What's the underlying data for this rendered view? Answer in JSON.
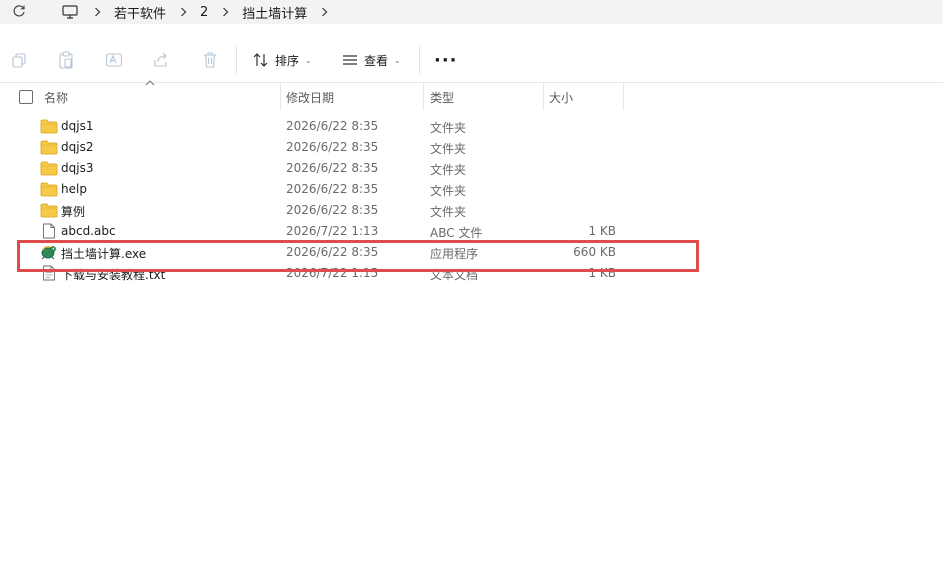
{
  "address_bar": {
    "crumbs": [
      "若干软件",
      "2",
      "挡土墙计算"
    ]
  },
  "toolbar": {
    "sort_label": "排序",
    "view_label": "查看",
    "more_label": "···"
  },
  "columns": {
    "name": "名称",
    "modified": "修改日期",
    "type": "类型",
    "size": "大小"
  },
  "files": [
    {
      "icon": "folder-icon",
      "name": "dqjs1",
      "modified": "2026/6/22 8:35",
      "type": "文件夹",
      "size": ""
    },
    {
      "icon": "folder-icon",
      "name": "dqjs2",
      "modified": "2026/6/22 8:35",
      "type": "文件夹",
      "size": ""
    },
    {
      "icon": "folder-icon",
      "name": "dqjs3",
      "modified": "2026/6/22 8:35",
      "type": "文件夹",
      "size": ""
    },
    {
      "icon": "folder-icon",
      "name": "help",
      "modified": "2026/6/22 8:35",
      "type": "文件夹",
      "size": ""
    },
    {
      "icon": "folder-icon",
      "name": "算例",
      "modified": "2026/6/22 8:35",
      "type": "文件夹",
      "size": ""
    },
    {
      "icon": "document-icon",
      "name": "abcd.abc",
      "modified": "2026/7/22 1:13",
      "type": "ABC 文件",
      "size": "1 KB"
    },
    {
      "icon": "app-exe-icon",
      "name": "挡土墙计算.exe",
      "modified": "2026/6/22 8:35",
      "type": "应用程序",
      "size": "660 KB"
    },
    {
      "icon": "text-file-icon",
      "name": "下载与安装教程.txt",
      "modified": "2026/7/22 1:15",
      "type": "文本文档",
      "size": "1 KB"
    }
  ],
  "colors": {
    "highlight_border": "#e04b4b",
    "folder_yellow": "#f7c948"
  }
}
